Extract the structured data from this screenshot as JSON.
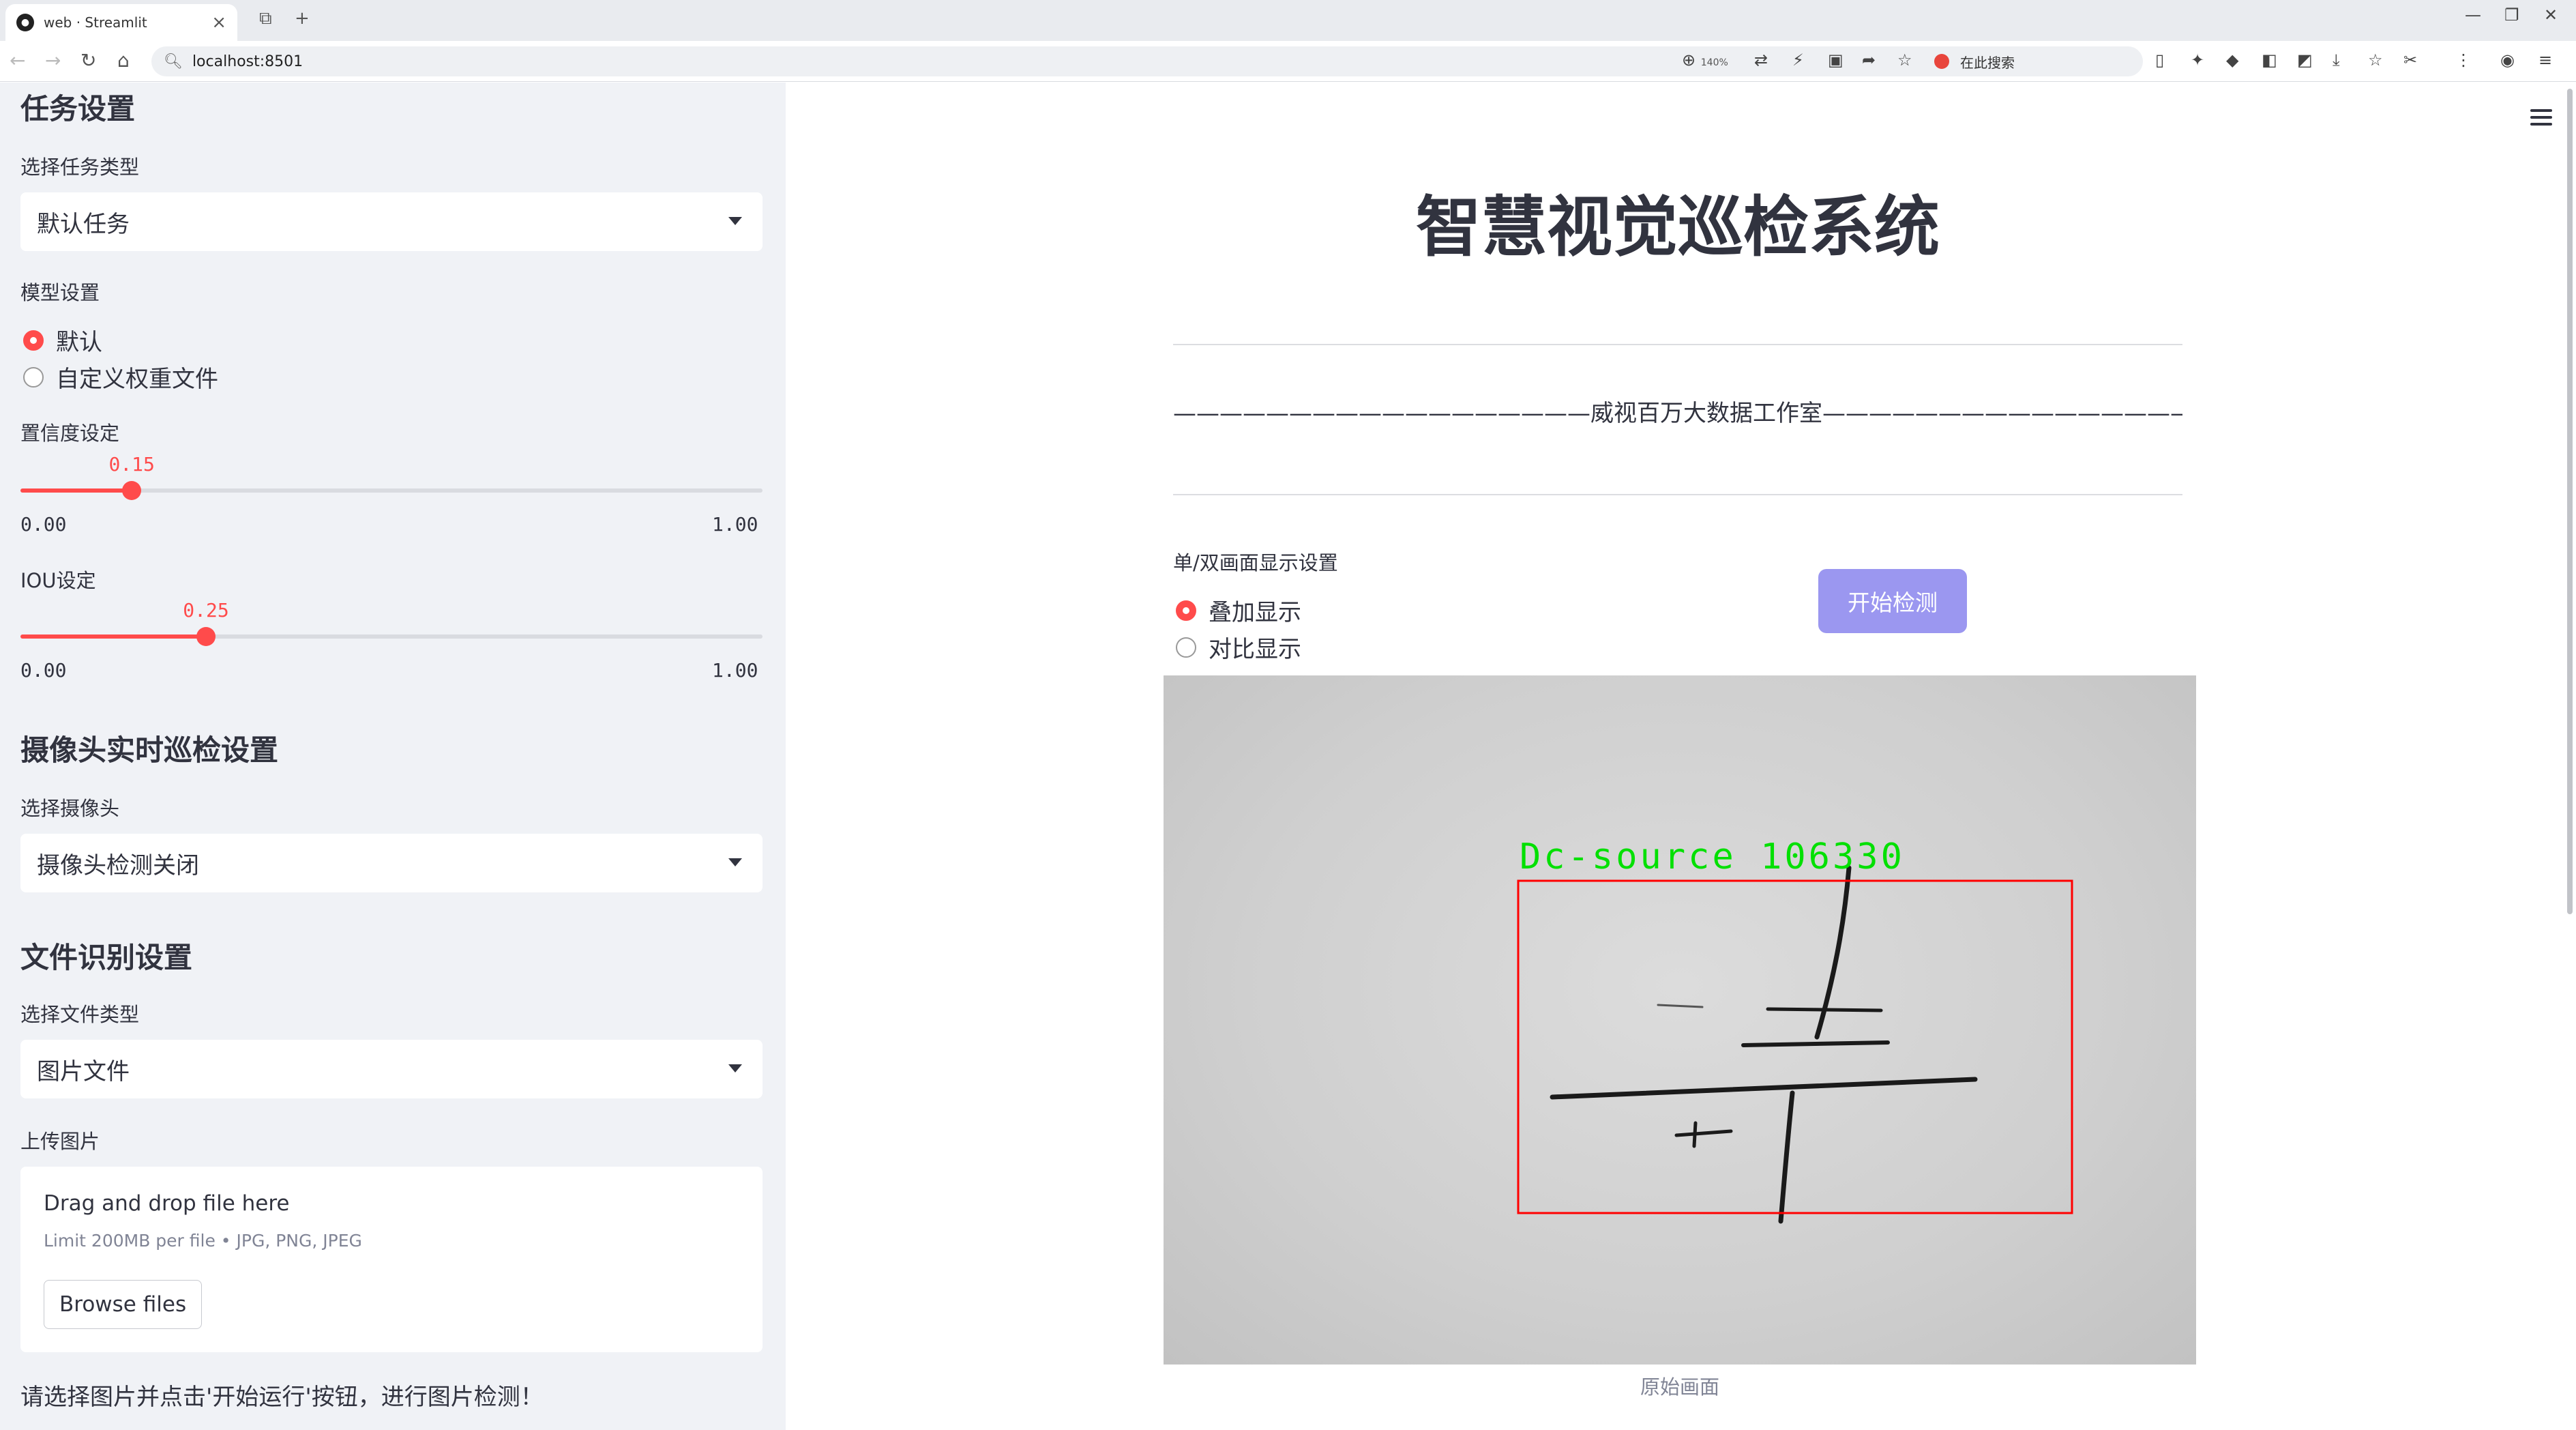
{
  "browser": {
    "tab_title": "web · Streamlit",
    "url": "localhost:8501",
    "zoom": "140%",
    "search_placeholder": "在此搜索"
  },
  "sidebar": {
    "task_heading": "任务设置",
    "task_type_label": "选择任务类型",
    "task_type_value": "默认任务",
    "model_label": "模型设置",
    "model_options": [
      {
        "label": "默认",
        "selected": true
      },
      {
        "label": "自定义权重文件",
        "selected": false
      }
    ],
    "confidence": {
      "label": "置信度设定",
      "value": 0.15,
      "value_text": "0.15",
      "min": "0.00",
      "max": "1.00"
    },
    "iou": {
      "label": "IOU设定",
      "value": 0.25,
      "value_text": "0.25",
      "min": "0.00",
      "max": "1.00"
    },
    "camera_heading": "摄像头实时巡检设置",
    "camera_label": "选择摄像头",
    "camera_value": "摄像头检测关闭",
    "file_heading": "文件识别设置",
    "file_type_label": "选择文件类型",
    "file_type_value": "图片文件",
    "upload_label": "上传图片",
    "upload": {
      "title": "Drag and drop file here",
      "limit": "Limit 200MB per file • JPG, PNG, JPEG",
      "button": "Browse files"
    },
    "note": "请选择图片并点击'开始运行'按钮，进行图片检测！"
  },
  "main": {
    "title": "智慧视觉巡检系统",
    "studio_line": "——————————————————威视百万大数据工作室———————————————————",
    "display_label": "单/双画面显示设置",
    "display_options": [
      {
        "label": "叠加显示",
        "selected": true
      },
      {
        "label": "对比显示",
        "selected": false
      }
    ],
    "start_button": "开始检测",
    "detection_label": "Dc-source 106330",
    "caption": "原始画面"
  },
  "colors": {
    "accent": "#ff4b4b",
    "button": "#9b97f0",
    "sidebar_bg": "#f0f2f6",
    "detection_box": "#ff0000",
    "detection_text": "#00e000"
  }
}
